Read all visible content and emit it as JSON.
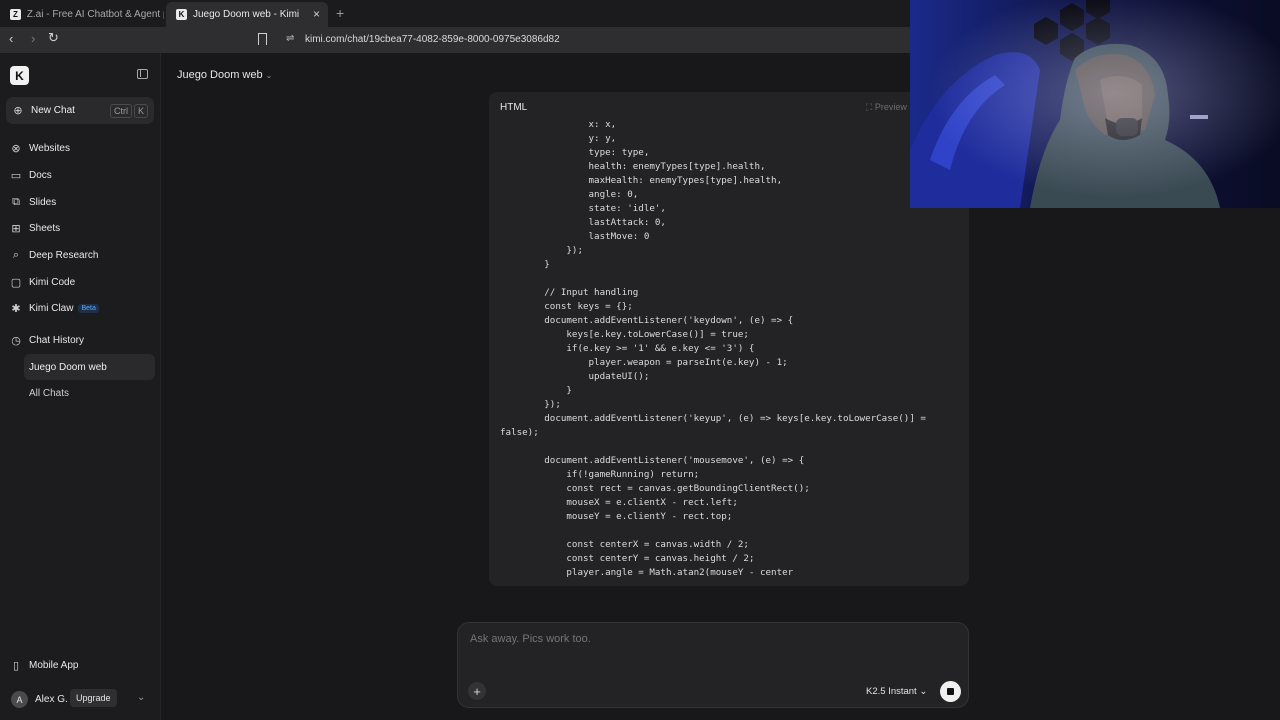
{
  "browser": {
    "tabs": [
      {
        "label": "Z.ai - Free AI Chatbot & Agent powe",
        "icon": "Z"
      },
      {
        "label": "Juego Doom web - Kimi",
        "icon": "K"
      }
    ],
    "url": "kimi.com/chat/19cbea77-4082-859e-8000-0975e3086d82"
  },
  "sidebar": {
    "logo": "K",
    "new_chat": "New Chat",
    "shortcut": [
      "Ctrl",
      "K"
    ],
    "items": [
      {
        "label": "Websites",
        "icon": "globe-icon"
      },
      {
        "label": "Docs",
        "icon": "document-icon"
      },
      {
        "label": "Slides",
        "icon": "slides-icon"
      },
      {
        "label": "Sheets",
        "icon": "grid-icon"
      },
      {
        "label": "Deep Research",
        "icon": "magnifier-icon"
      },
      {
        "label": "Kimi Code",
        "icon": "code-icon"
      },
      {
        "label": "Kimi Claw",
        "icon": "claw-icon",
        "badge": "Beta"
      }
    ],
    "chat_history": "Chat History",
    "history_items": [
      "Juego Doom web"
    ],
    "all_chats": "All Chats",
    "mobile_app": "Mobile App",
    "user": {
      "initial": "A",
      "name": "Alex G.",
      "upgrade": "Upgrade"
    }
  },
  "main": {
    "chat_title": "Juego Doom web",
    "code": {
      "language": "HTML",
      "preview": "Preview",
      "lines": [
        "                x: x,",
        "                y: y,",
        "                type: type,",
        "                health: enemyTypes[type].health,",
        "                maxHealth: enemyTypes[type].health,",
        "                angle: 0,",
        "                state: 'idle',",
        "                lastAttack: 0,",
        "                lastMove: 0",
        "            });",
        "        }",
        "",
        "        // Input handling",
        "        const keys = {};",
        "        document.addEventListener('keydown', (e) => {",
        "            keys[e.key.toLowerCase()] = true;",
        "            if(e.key >= '1' && e.key <= '3') {",
        "                player.weapon = parseInt(e.key) - 1;",
        "                updateUI();",
        "            }",
        "        });",
        "        document.addEventListener('keyup', (e) => keys[e.key.toLowerCase()] =",
        "false);",
        "",
        "        document.addEventListener('mousemove', (e) => {",
        "            if(!gameRunning) return;",
        "            const rect = canvas.getBoundingClientRect();",
        "            mouseX = e.clientX - rect.left;",
        "            mouseY = e.clientY - rect.top;",
        "",
        "            const centerX = canvas.width / 2;",
        "            const centerY = canvas.height / 2;",
        "            player.angle = Math.atan2(mouseY - center"
      ]
    },
    "composer": {
      "placeholder": "Ask away. Pics work too.",
      "model": "K2.5 Instant"
    }
  }
}
